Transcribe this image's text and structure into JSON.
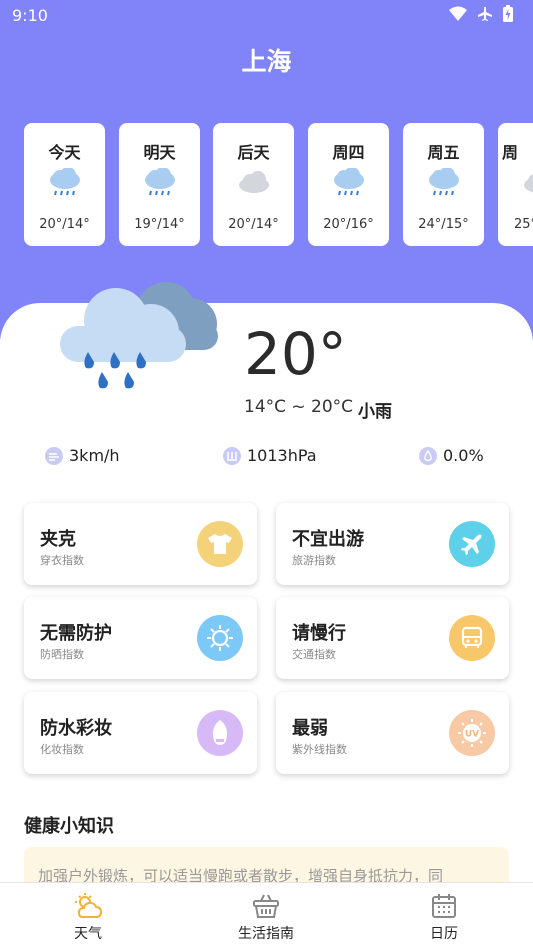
{
  "status_bar": {
    "time": "9:10"
  },
  "city": "上海",
  "forecast": [
    {
      "day": "今天",
      "temp": "20°/14°",
      "icon": "rain-cloud-icon"
    },
    {
      "day": "明天",
      "temp": "19°/14°",
      "icon": "rain-cloud-icon"
    },
    {
      "day": "后天",
      "temp": "20°/14°",
      "icon": "cloud-icon"
    },
    {
      "day": "周四",
      "temp": "20°/16°",
      "icon": "rain-cloud-icon"
    },
    {
      "day": "周五",
      "temp": "24°/15°",
      "icon": "rain-cloud-icon"
    },
    {
      "day": "周",
      "temp": "25°",
      "icon": "cloud-icon"
    }
  ],
  "current": {
    "temp": "20°",
    "range": "14°C ~ 20°C",
    "desc": "小雨",
    "wind": "3km/h",
    "pressure": "1013hPa",
    "precip": "0.0%"
  },
  "indices": [
    {
      "title": "夹克",
      "sub": "穿衣指数",
      "icon": "shirt-icon",
      "color": "#f3d27a"
    },
    {
      "title": "不宜出游",
      "sub": "旅游指数",
      "icon": "plane-icon",
      "color": "#5ed0ea"
    },
    {
      "title": "无需防护",
      "sub": "防晒指数",
      "icon": "sun-icon",
      "color": "#7cc8f7"
    },
    {
      "title": "请慢行",
      "sub": "交通指数",
      "icon": "bus-icon",
      "color": "#f7c76a"
    },
    {
      "title": "防水彩妆",
      "sub": "化妆指数",
      "icon": "makeup-icon",
      "color": "#d6b9f6"
    },
    {
      "title": "最弱",
      "sub": "紫外线指数",
      "icon": "uv-icon",
      "color": "#f7c9a4"
    }
  ],
  "health": {
    "title": "健康小知识",
    "text": "加强户外锻炼，可以适当慢跑或者散步，增强自身抵抗力，同"
  },
  "tabs": [
    {
      "label": "天气",
      "icon": "weather-tab-icon"
    },
    {
      "label": "生活指南",
      "icon": "basket-tab-icon"
    },
    {
      "label": "日历",
      "icon": "calendar-tab-icon"
    }
  ],
  "colors": {
    "header": "#8183f9",
    "accent": "#f2b233"
  }
}
